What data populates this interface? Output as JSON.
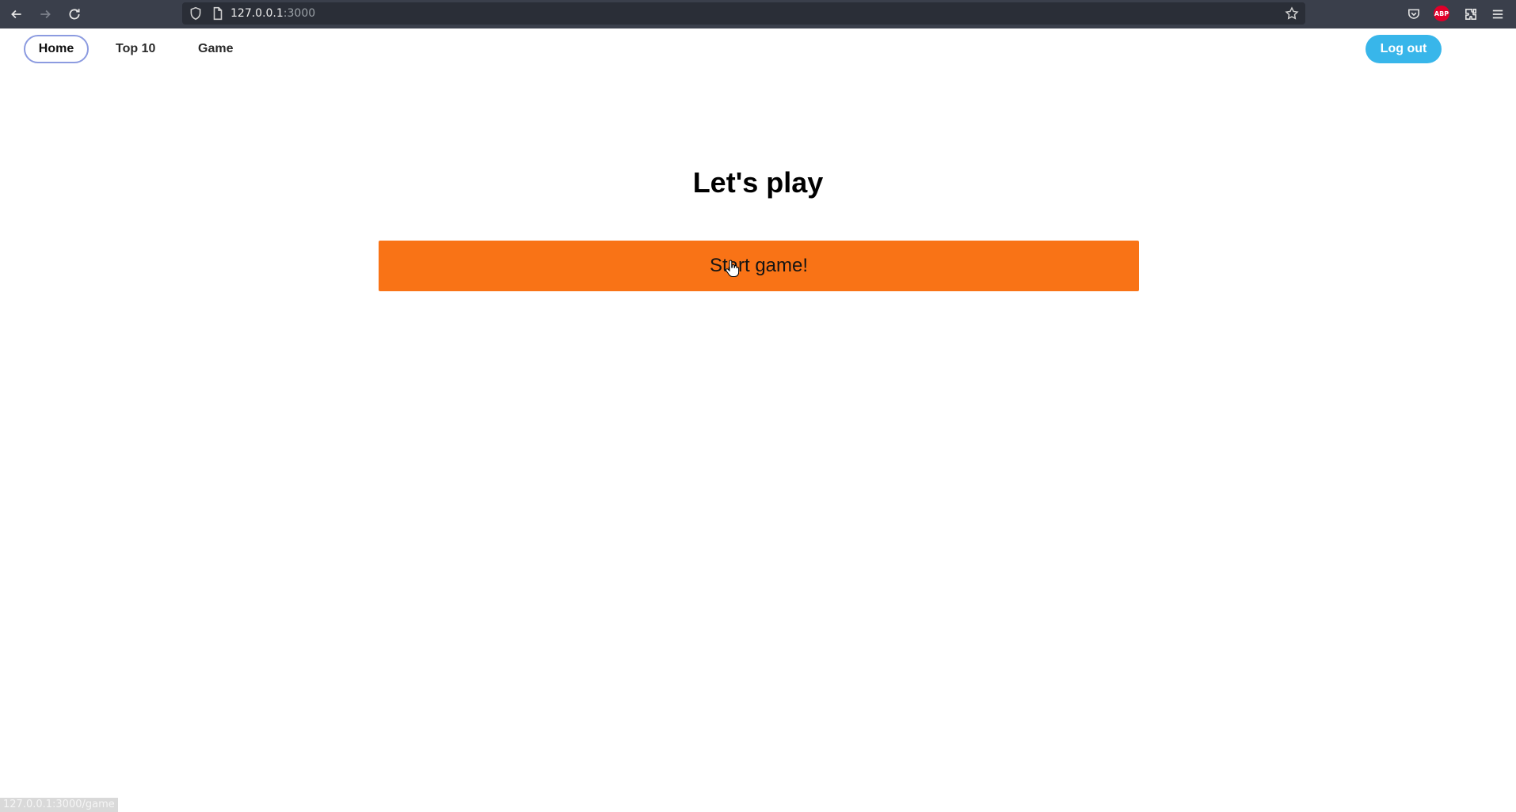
{
  "browser": {
    "url_host": "127.0.0.1",
    "url_port": ":3000",
    "abp_label": "ABP",
    "status_url": "127.0.0.1:3000/game"
  },
  "nav": {
    "home": "Home",
    "top10": "Top 10",
    "game": "Game",
    "logout": "Log out"
  },
  "main": {
    "title": "Let's play",
    "start_button": "Start game!"
  },
  "colors": {
    "start_button_bg": "#f97316",
    "logout_bg": "#38b6ea",
    "toolbar_bg": "#3a3f4b"
  }
}
